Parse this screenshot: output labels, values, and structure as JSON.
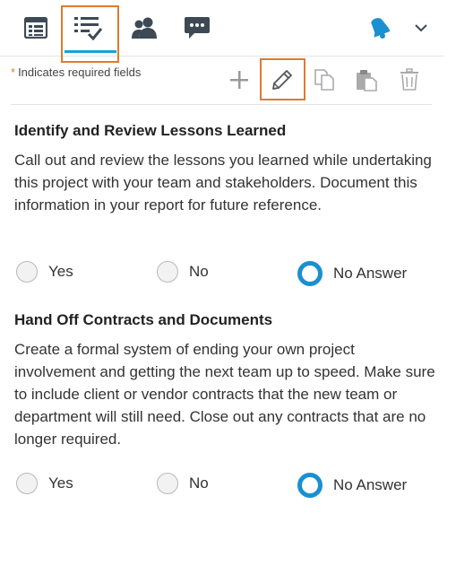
{
  "tabs": {
    "sheet": "sheet-icon",
    "tasks": "checklist-icon",
    "people": "people-icon",
    "chat": "chat-icon",
    "bell": "bell-icon",
    "menu": "chevron-down-icon",
    "active_color": "#1aa0dc"
  },
  "required_note": {
    "star": "*",
    "text": "Indicates required fields"
  },
  "toolbar": {
    "add": "plus-icon",
    "edit": "pencil-icon",
    "copy": "copy-icon",
    "paste": "paste-icon",
    "delete": "trash-icon"
  },
  "highlight_color": "#e07a2e",
  "sections": [
    {
      "title": "Identify and Review Lessons Learned",
      "description": "Call out and review the lessons you learned while undertaking this project with your team and stakeholders. Document this information in your report for future reference.",
      "options": [
        "Yes",
        "No",
        "No Answer"
      ],
      "selected": "No Answer"
    },
    {
      "title": "Hand Off Contracts and Documents",
      "description": "Create a formal system of ending your own project involvement and getting the next team up to speed. Make sure to include client or vendor contracts that the new team or department will still need. Close out any contracts that are no longer required.",
      "options": [
        "Yes",
        "No",
        "No Answer"
      ],
      "selected": "No Answer"
    }
  ]
}
